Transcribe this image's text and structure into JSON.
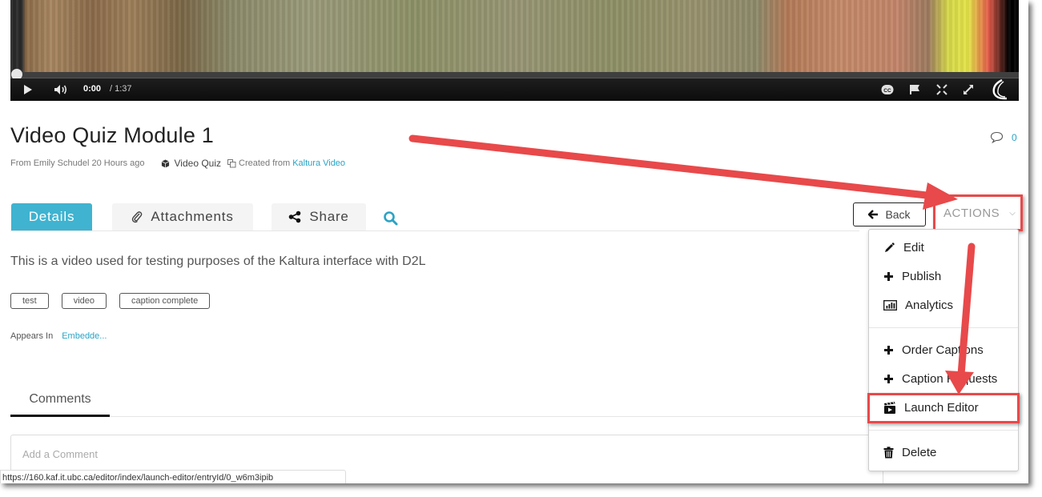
{
  "player": {
    "current_time": "0:00",
    "total_time": "/ 1:37",
    "progress_fraction": 0.0,
    "controls": [
      "play-icon",
      "volume-icon",
      "closed-captions-icon",
      "report-flag-icon",
      "fullscreen-icon",
      "expand-icon",
      "kaltura-logo-icon"
    ]
  },
  "entry": {
    "title": "Video Quiz Module 1",
    "from": "From Emily Schudel 20 Hours ago",
    "type": "Video Quiz",
    "created_prefix": "Created from",
    "created_link": "Kaltura Video",
    "comment_count": "0"
  },
  "tabs": {
    "details": "Details",
    "attachments": "Attachments",
    "share": "Share"
  },
  "buttons": {
    "back": "Back",
    "actions": "ACTIONS"
  },
  "details": {
    "description": "This is a video used for testing purposes of the Kaltura interface with D2L",
    "tags": [
      "test",
      "video",
      "caption complete"
    ],
    "appears_in_label": "Appears In",
    "appears_in_link": "Embedde..."
  },
  "actions_menu": {
    "items": [
      {
        "label": "Edit",
        "icon": "pencil-icon"
      },
      {
        "label": "Publish",
        "icon": "plus-icon"
      },
      {
        "label": "Analytics",
        "icon": "bar-chart-icon"
      },
      {
        "label": "Order Captions",
        "icon": "plus-icon"
      },
      {
        "label": "Caption Requests",
        "icon": "plus-icon"
      },
      {
        "label": "Launch Editor",
        "icon": "clapperboard-icon"
      },
      {
        "label": "Delete",
        "icon": "trash-icon"
      }
    ]
  },
  "comments": {
    "tab_label": "Comments",
    "placeholder": "Add a Comment"
  },
  "status_bar": {
    "url": "https://160.kaf.it.ubc.ca/editor/index/launch-editor/entryId/0_w6m3ipib"
  },
  "colors": {
    "accent": "#3fb3d0",
    "link": "#2aa3c4",
    "annotation": "#e8494a"
  }
}
